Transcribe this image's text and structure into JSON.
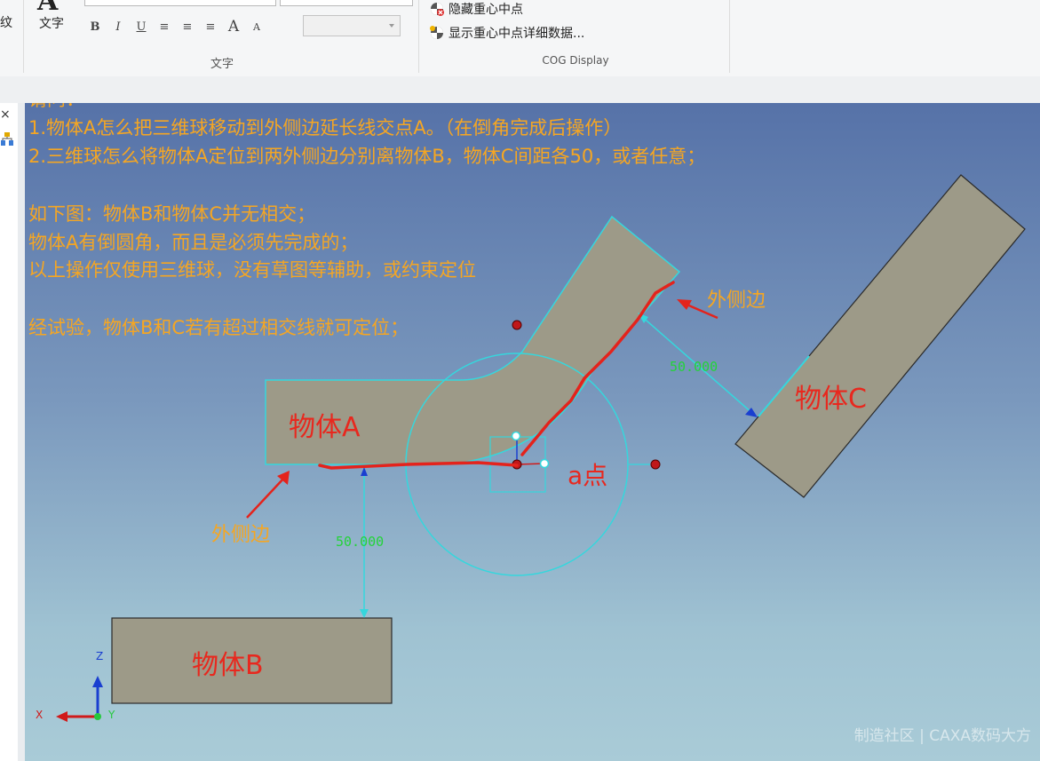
{
  "ribbon": {
    "cut_label": "纹",
    "big_letter": "A",
    "text_button_label": "文字",
    "format_buttons": [
      "B",
      "I",
      "U",
      "≡",
      "≡",
      "≡",
      "A",
      "A"
    ],
    "text_group_label": "文字",
    "cog": {
      "hide_label": "隐藏重心中点",
      "show_label": "显示重心中点详细数据...",
      "group_label": "COG Display"
    }
  },
  "panel": {
    "close": "×"
  },
  "viewport": {
    "notes": [
      "请问：",
      "1.物体A怎么把三维球移动到外侧边延长线交点A。（在倒角完成后操作）",
      "2.三维球怎么将物体A定位到两外侧边分别离物体B，物体C间距各50，或者任意；",
      "如下图：物体B和物体C并无相交；",
      "物体A有倒圆角，而且是必须先完成的；",
      "以上操作仅使用三维球，没有草图等辅助，或约束定位",
      "经试验，物体B和C若有超过相交线就可定位；"
    ],
    "object_a": "物体A",
    "object_b": "物体B",
    "object_c": "物体C",
    "point_a": "a点",
    "outer_edge_left": "外侧边",
    "outer_edge_right": "外侧边",
    "dim_1": "50.000",
    "dim_2": "50.000",
    "axis_z": "Z",
    "axis_x": "X",
    "axis_y": "Y",
    "watermark": "制造社区 | CAXA数码大方"
  },
  "colors": {
    "part_fill": "#9d9a88",
    "cyan_edge": "#35d7dd",
    "red_mark": "#e4231c",
    "note_orange": "#f5a623",
    "dim_green": "#24d33a"
  }
}
